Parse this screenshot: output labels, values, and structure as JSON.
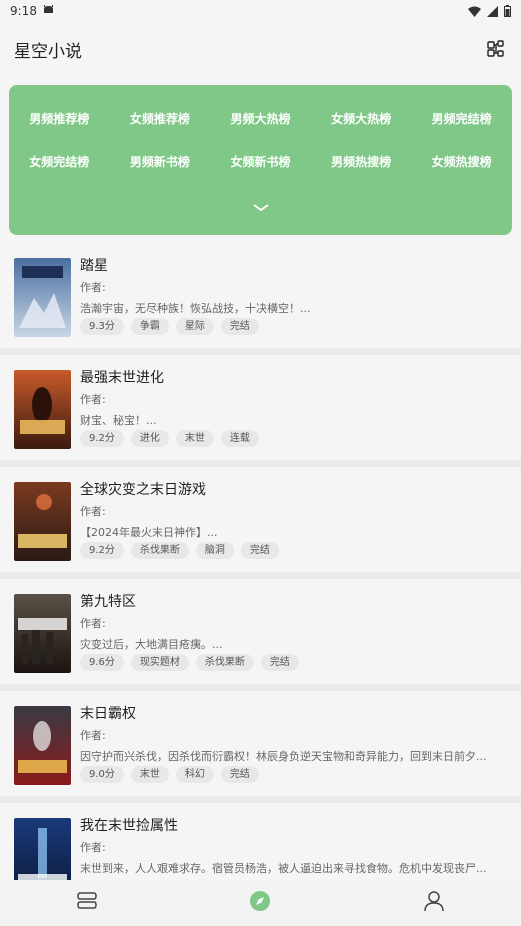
{
  "status": {
    "time": "9:18"
  },
  "header": {
    "title": "星空小说"
  },
  "rankings": [
    "男频推荐榜",
    "女频推荐榜",
    "男频大热榜",
    "女频大热榜",
    "男频完结榜",
    "女频完结榜",
    "男频新书榜",
    "女频新书榜",
    "男频热搜榜",
    "女频热搜榜"
  ],
  "books": [
    {
      "title": "踏星",
      "author": "作者:",
      "intro": "浩瀚宇宙，无尽种族！恢弘战技，十决横空！...",
      "tags": [
        "9.3分",
        "争霸",
        "星际",
        "完结"
      ]
    },
    {
      "title": "最强末世进化",
      "author": "作者:",
      "intro": "财宝、秘宝！...",
      "tags": [
        "9.2分",
        "进化",
        "末世",
        "连载"
      ]
    },
    {
      "title": "全球灾变之末日游戏",
      "author": "作者:",
      "intro": "【2024年最火末日神作】...",
      "tags": [
        "9.2分",
        "杀伐果断",
        "脑洞",
        "完结"
      ]
    },
    {
      "title": "第九特区",
      "author": "作者:",
      "intro": "灾变过后，大地满目疮痍。...",
      "tags": [
        "9.6分",
        "现实题材",
        "杀伐果断",
        "完结"
      ]
    },
    {
      "title": "末日霸权",
      "author": "作者:",
      "intro": "因守护而兴杀伐，因杀伐而衍霸权！林辰身负逆天宝物和奇异能力，回到末日前夕...",
      "tags": [
        "9.0分",
        "末世",
        "科幻",
        "完结"
      ]
    },
    {
      "title": "我在末世捡属性",
      "author": "作者:",
      "intro": "末世到来，人人艰难求存。宿管员杨浩，被人逼迫出来寻找食物。危机中发现丧尸...",
      "tags": []
    }
  ],
  "nav": {
    "items": [
      "bookshelf-icon",
      "discover-icon",
      "profile-icon"
    ],
    "active_color": "#7fc887"
  },
  "colors": {
    "panel": "#7fc887"
  }
}
